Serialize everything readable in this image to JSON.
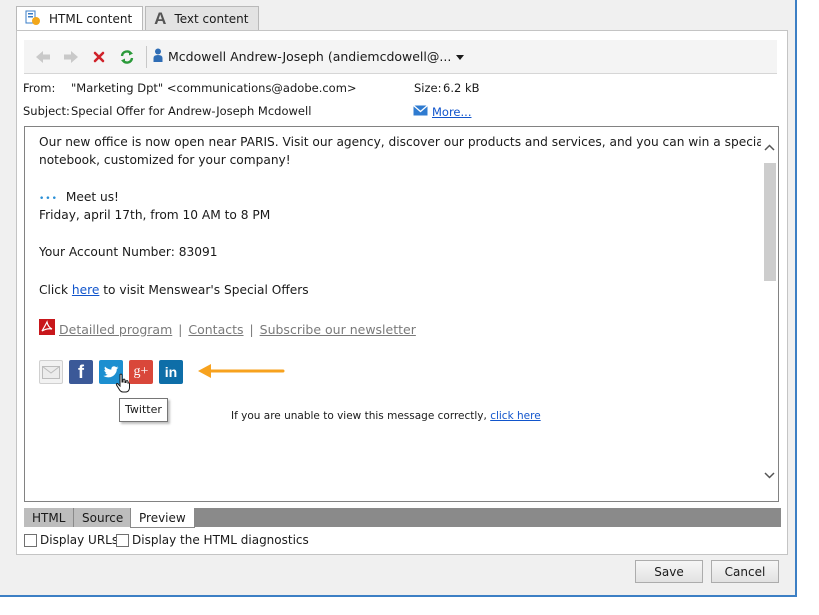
{
  "tabs": [
    {
      "label": "HTML content",
      "icon": "html-content-icon",
      "active": true
    },
    {
      "label": "Text content",
      "icon": "text-A-icon",
      "active": false
    }
  ],
  "toolbar": {
    "recipient": "Mcdowell Andrew-Joseph (andiemcdowell@...",
    "icons": [
      "back-arrow-icon",
      "forward-arrow-icon",
      "delete-x-icon",
      "refresh-icon",
      "person-icon",
      "dropdown-triangle-icon"
    ]
  },
  "header": {
    "from_label": "From:",
    "from_value": "\"Marketing Dpt\" <communications@adobe.com>",
    "subject_label": "Subject:",
    "subject_value": "Special Offer for Andrew-Joseph Mcdowell",
    "size_label": "Size:",
    "size_value": "6.2 kB",
    "more_link": "More..."
  },
  "message": {
    "para1_line1": "Our new office is now open near PARIS. Visit our agency, discover our products and services, and you can win a special",
    "para1_line2": "notebook, customized for your company!",
    "meet_dots": "•••",
    "meet_us": "Meet us!",
    "date_line": "Friday, april 17th, from 10 AM to 8 PM",
    "account_line": "Your Account Number: 83091",
    "click_prefix": "Click",
    "click_link": "here",
    "click_suffix": "to visit Menswear's Special Offers",
    "links": [
      "Detailled program",
      "Contacts",
      "Subscribe our newsletter"
    ],
    "link_separator": "|",
    "tooltip": "Twitter",
    "unable_text": "If you are unable to view this message correctly,",
    "unable_link": "click here"
  },
  "view_tabs": [
    {
      "label": "HTML",
      "active": false
    },
    {
      "label": "Source",
      "active": false
    },
    {
      "label": "Preview",
      "active": true
    }
  ],
  "checkboxes": [
    {
      "label": "Display URLs",
      "checked": false
    },
    {
      "label": "Display the HTML diagnostics",
      "checked": false
    }
  ],
  "buttons": {
    "save": "Save",
    "cancel": "Cancel"
  },
  "colors": {
    "facebook": "#3b5998",
    "twitter": "#1d8fd0",
    "googleplus": "#d9473a",
    "linkedin": "#0e6ea8",
    "arrow": "#f7a21e",
    "window_border": "#3c7fc4"
  }
}
